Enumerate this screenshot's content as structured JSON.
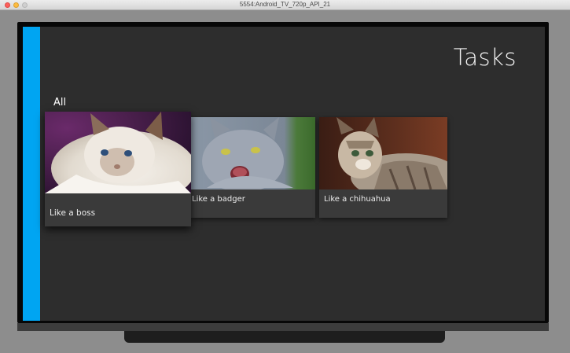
{
  "window": {
    "title": "5554:Android_TV_720p_API_21"
  },
  "screen": {
    "title": "Tasks",
    "row_header": "All",
    "cards": [
      {
        "caption": "Like a boss",
        "image": "ragdoll-cat-photo",
        "focused": true
      },
      {
        "caption": "Like a badger",
        "image": "hissing-gray-cat-photo",
        "focused": false
      },
      {
        "caption": "Like a chihuahua",
        "image": "tabby-cat-photo",
        "focused": false
      }
    ]
  },
  "colors": {
    "nav_rail": "#00a5f2",
    "screen_background": "#2d2d2d",
    "card_background": "#3a3a3a"
  }
}
